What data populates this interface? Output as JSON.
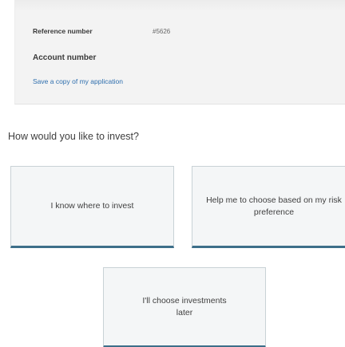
{
  "summary": {
    "reference_label": "Reference number",
    "reference_value": "#5626",
    "account_label": "Account number",
    "save_link": "Save a copy of my application"
  },
  "question": "How would you like to invest?",
  "options": [
    {
      "label": "I know where to invest"
    },
    {
      "label": "Help me to choose based on my risk preference"
    },
    {
      "label": "I'll choose investments later"
    }
  ],
  "colors": {
    "panel_background": "#f3f3f3",
    "link": "#2f6fae",
    "card_accent": "#3d6f8a",
    "card_background": "#f4f6f7"
  }
}
